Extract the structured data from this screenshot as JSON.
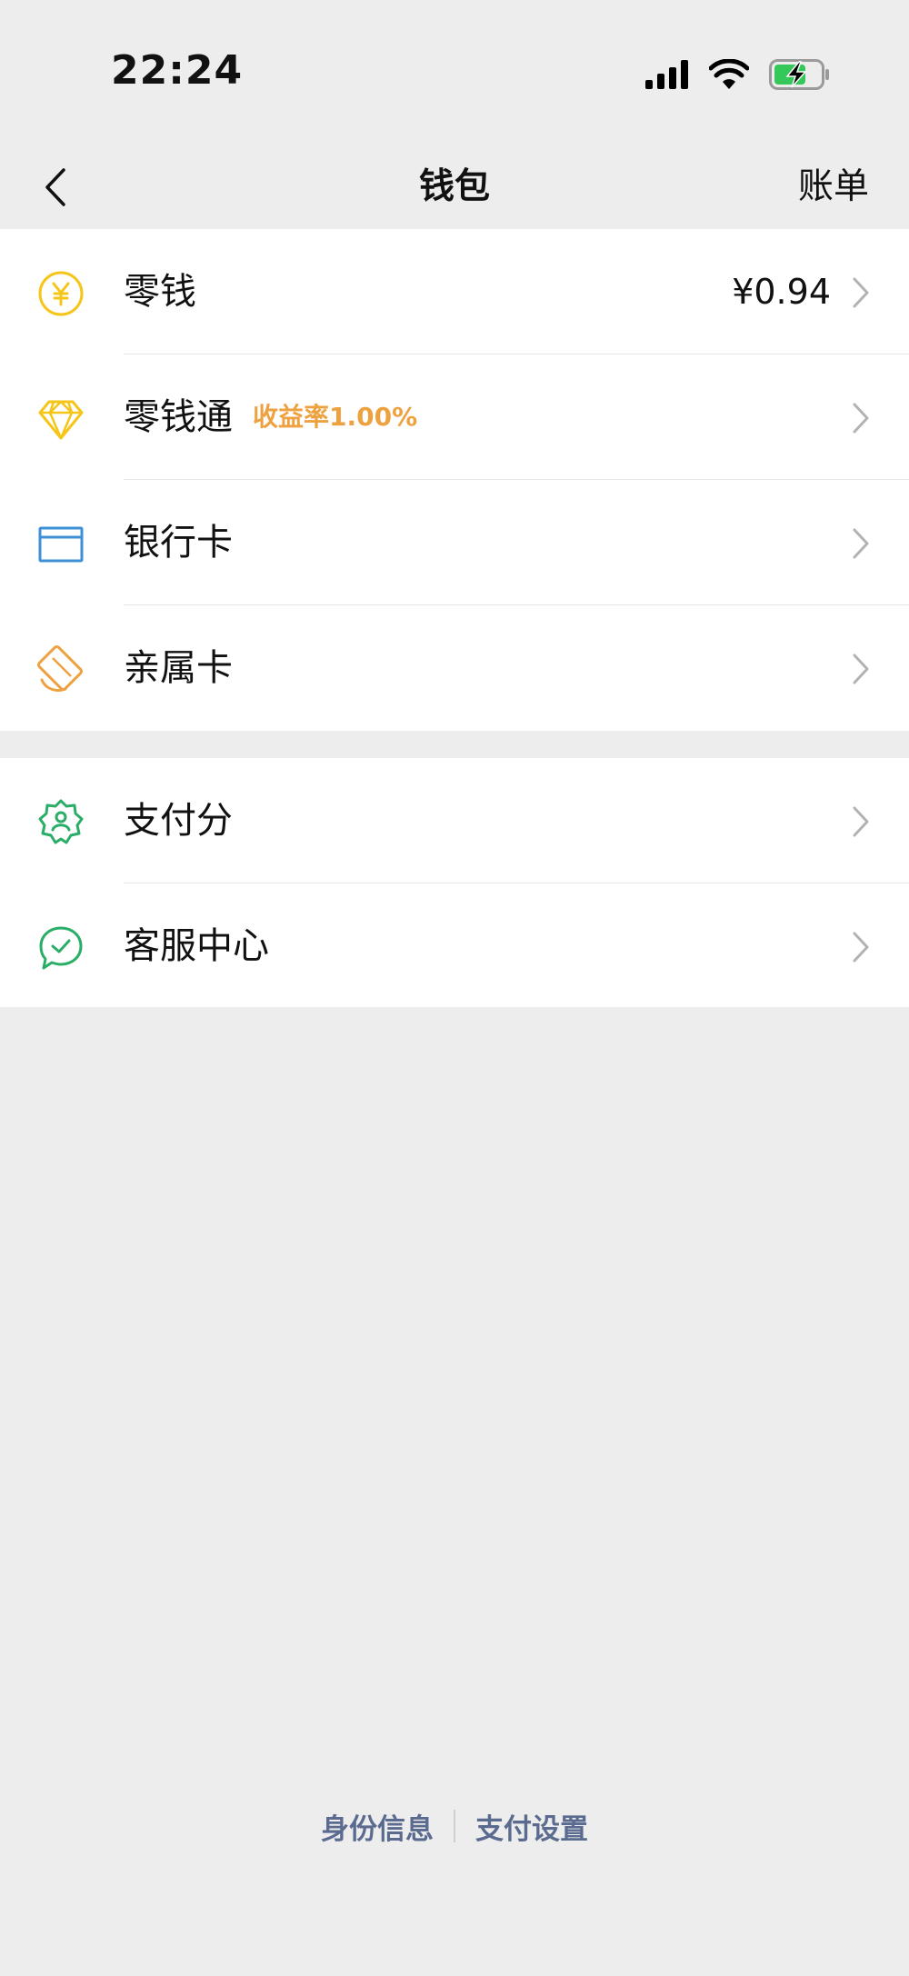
{
  "status_bar": {
    "time": "22:24",
    "icons": [
      "signal-icon",
      "wifi-icon",
      "battery-charging-icon"
    ]
  },
  "navbar": {
    "back_icon": "back-chevron-icon",
    "title": "钱包",
    "bill_label": "账单"
  },
  "group1": [
    {
      "label": "零钱",
      "value": "¥0.94",
      "icon": "yuan-coin-icon",
      "icon_color": "#f5c518"
    },
    {
      "label": "零钱通",
      "badge": "收益率1.00%",
      "icon": "diamond-icon",
      "icon_color": "#f5c518",
      "badge_color": "#eea13f"
    },
    {
      "label": "银行卡",
      "icon": "bank-card-icon",
      "icon_color": "#3d8fd6"
    },
    {
      "label": "亲属卡",
      "icon": "family-card-icon",
      "icon_color": "#eea13f"
    }
  ],
  "group2": [
    {
      "label": "支付分",
      "icon": "pay-score-icon",
      "icon_color": "#2aae67"
    },
    {
      "label": "客服中心",
      "icon": "customer-service-icon",
      "icon_color": "#2aae67"
    }
  ],
  "footer": {
    "identity_label": "身份信息",
    "settings_label": "支付设置",
    "link_color": "#5b6b90"
  }
}
